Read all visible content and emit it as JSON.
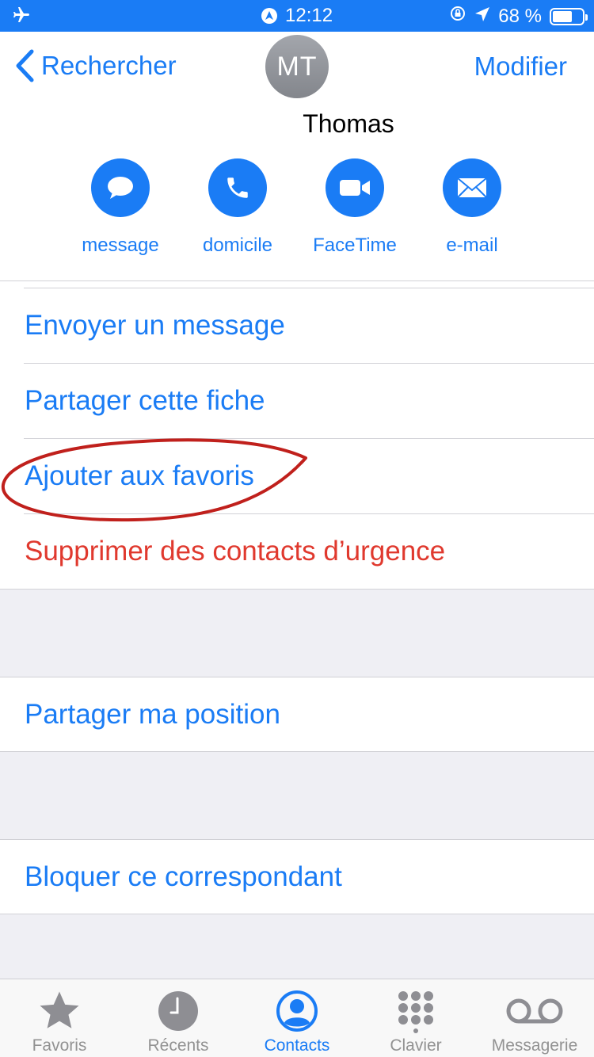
{
  "status_bar": {
    "time": "12:12",
    "battery": "68 %",
    "battery_level": 0.68,
    "icons": [
      "airplane-icon",
      "location-badge-icon",
      "rotation-lock-icon",
      "location-arrow-icon",
      "battery-icon"
    ]
  },
  "nav": {
    "back_label": "Rechercher",
    "edit_label": "Modifier"
  },
  "contact": {
    "initials": "MT",
    "name": "Thomas"
  },
  "actions": [
    {
      "label": "message",
      "icon": "message-bubble-icon"
    },
    {
      "label": "domicile",
      "icon": "phone-icon"
    },
    {
      "label": "FaceTime",
      "icon": "video-camera-icon"
    },
    {
      "label": "e-mail",
      "icon": "envelope-icon"
    }
  ],
  "menu": {
    "send_message": "Envoyer un message",
    "share_card": "Partager cette fiche",
    "add_favorites": "Ajouter aux favoris",
    "remove_emergency": "Supprimer des contacts d’urgence",
    "share_location": "Partager ma position",
    "block_caller": "Bloquer ce correspondant"
  },
  "tabs": [
    {
      "label": "Favoris",
      "icon": "star-icon",
      "active": false
    },
    {
      "label": "Récents",
      "icon": "clock-icon",
      "active": false
    },
    {
      "label": "Contacts",
      "icon": "contacts-icon",
      "active": true
    },
    {
      "label": "Clavier",
      "icon": "keypad-icon",
      "active": false
    },
    {
      "label": "Messagerie",
      "icon": "voicemail-icon",
      "active": false
    }
  ],
  "colors": {
    "accent": "#1a7cf5",
    "destructive": "#e0392e",
    "annotation": "#c0201c",
    "group_background": "#efeff4"
  }
}
